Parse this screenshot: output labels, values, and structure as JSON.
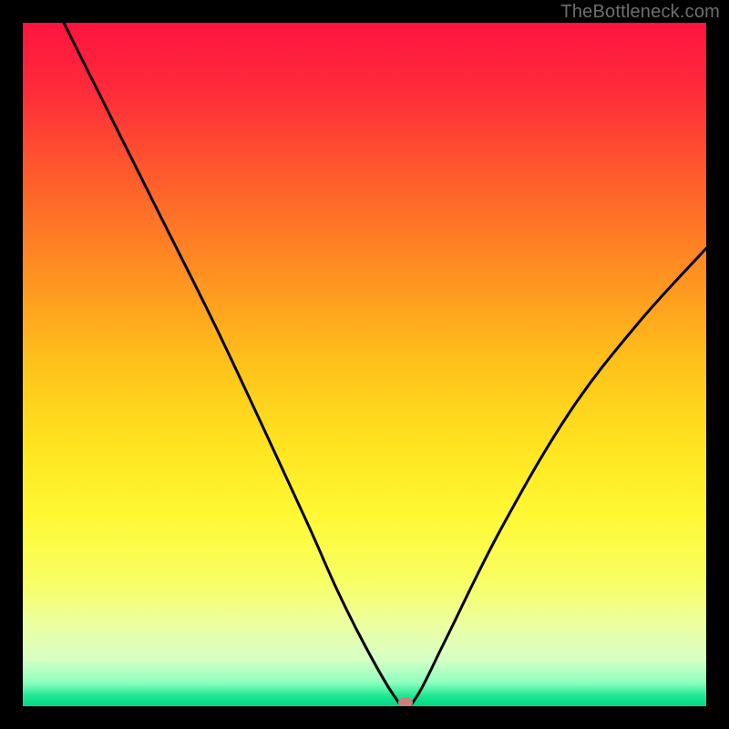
{
  "watermark": "TheBottleneck.com",
  "chart_data": {
    "type": "line",
    "title": "",
    "xlabel": "",
    "ylabel": "",
    "xlim": [
      0,
      100
    ],
    "ylim": [
      0,
      100
    ],
    "grid": false,
    "background": "rainbow-vertical",
    "series": [
      {
        "name": "bottleneck-curve",
        "x": [
          6,
          12,
          20,
          28,
          36,
          42,
          46,
          50,
          54,
          56,
          58,
          62,
          70,
          80,
          90,
          100
        ],
        "y": [
          100,
          88,
          72,
          56,
          39,
          26,
          17,
          9,
          2,
          0,
          2,
          10,
          26,
          43,
          56,
          67
        ]
      }
    ],
    "marker": {
      "x": 56,
      "y": 0,
      "color": "#c98078"
    },
    "gradient_stops": [
      {
        "offset": 0.0,
        "color": "#ff1440"
      },
      {
        "offset": 0.1,
        "color": "#ff2b3a"
      },
      {
        "offset": 0.22,
        "color": "#ff5a2c"
      },
      {
        "offset": 0.35,
        "color": "#ff8a22"
      },
      {
        "offset": 0.5,
        "color": "#ffc21a"
      },
      {
        "offset": 0.62,
        "color": "#ffe420"
      },
      {
        "offset": 0.72,
        "color": "#fff833"
      },
      {
        "offset": 0.82,
        "color": "#f8ff66"
      },
      {
        "offset": 0.88,
        "color": "#ecffa0"
      },
      {
        "offset": 0.93,
        "color": "#d7ffc4"
      },
      {
        "offset": 0.965,
        "color": "#8effc0"
      },
      {
        "offset": 0.985,
        "color": "#1fe892"
      },
      {
        "offset": 1.0,
        "color": "#00d884"
      }
    ]
  }
}
